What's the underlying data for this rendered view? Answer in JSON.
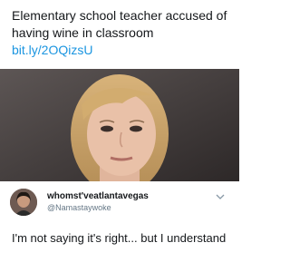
{
  "post": {
    "headline": "Elementary school teacher accused of having wine in classroom",
    "link": "bit.ly/2OQizsU",
    "image_alt": "photo-of-woman"
  },
  "tweet": {
    "display_name": "whomst'veatlantavegas",
    "handle": "@Namastaywoke",
    "text": "I'm not saying it's right... but I understand"
  },
  "colors": {
    "link": "#1b95e0",
    "handle": "#657786",
    "text": "#14171a"
  }
}
